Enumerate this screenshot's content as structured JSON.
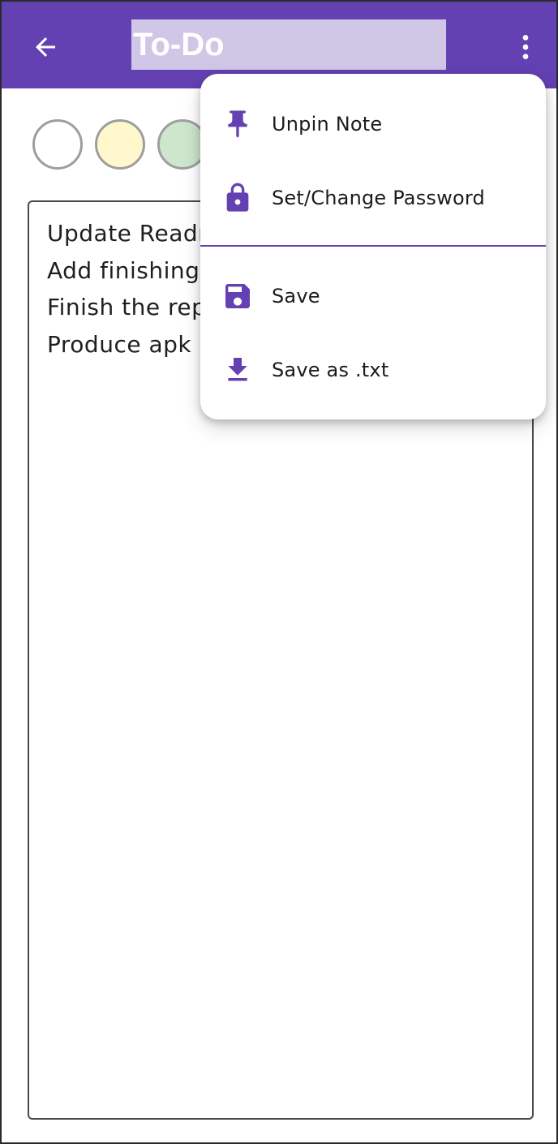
{
  "colors": {
    "accent": "#6441b3",
    "title_field_bg": "#d0c7e6",
    "swatches": [
      "#ffffff",
      "#fff8cc",
      "#cde6cc"
    ]
  },
  "app_bar": {
    "title": "To-Do",
    "back_icon": "arrow-back-icon",
    "overflow_icon": "more-vert-icon"
  },
  "note": {
    "lines": [
      "Update Readme",
      "Add finishing touches",
      "Finish the report",
      "Produce apk"
    ]
  },
  "menu": {
    "items": [
      {
        "label": "Unpin Note",
        "icon": "pin-icon"
      },
      {
        "label": "Set/Change Password",
        "icon": "lock-icon"
      },
      {
        "label": "Save",
        "icon": "save-icon"
      },
      {
        "label": "Save as .txt",
        "icon": "download-icon"
      }
    ]
  }
}
